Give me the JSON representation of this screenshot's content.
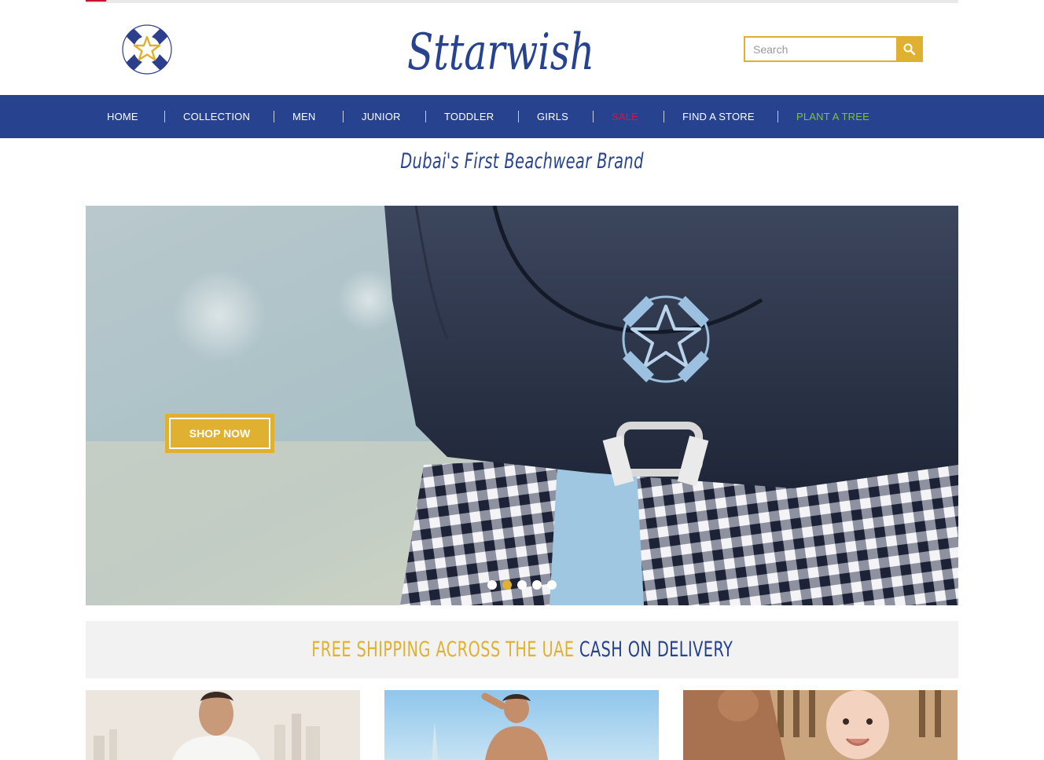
{
  "header": {
    "logo_text": "Sttarwish",
    "search": {
      "placeholder": "Search",
      "value": ""
    }
  },
  "nav": {
    "items": [
      {
        "label": "HOME",
        "color": "#ffffff"
      },
      {
        "label": "COLLECTION",
        "color": "#ffffff"
      },
      {
        "label": "MEN",
        "color": "#ffffff"
      },
      {
        "label": "JUNIOR",
        "color": "#ffffff"
      },
      {
        "label": "TODDLER",
        "color": "#ffffff"
      },
      {
        "label": "GIRLS",
        "color": "#ffffff"
      },
      {
        "label": "SALE",
        "color": "#e3103c"
      },
      {
        "label": "FIND A STORE",
        "color": "#ffffff"
      },
      {
        "label": "PLANT A TREE",
        "color": "#7cc142"
      }
    ]
  },
  "tagline": "Dubai's First Beachwear Brand",
  "hero": {
    "cta_label": "SHOP NOW",
    "slides_count": 5,
    "active_slide": 2
  },
  "promo": {
    "part1": "FREE SHIPPING ACROSS THE UAE",
    "part2": "CASH ON DELIVERY"
  },
  "colors": {
    "brand_blue": "#27438f",
    "accent_gold": "#e0b131",
    "sale_red": "#e3103c",
    "tree_green": "#7cc142"
  },
  "icons": [
    "emblem-icon",
    "search-icon"
  ]
}
